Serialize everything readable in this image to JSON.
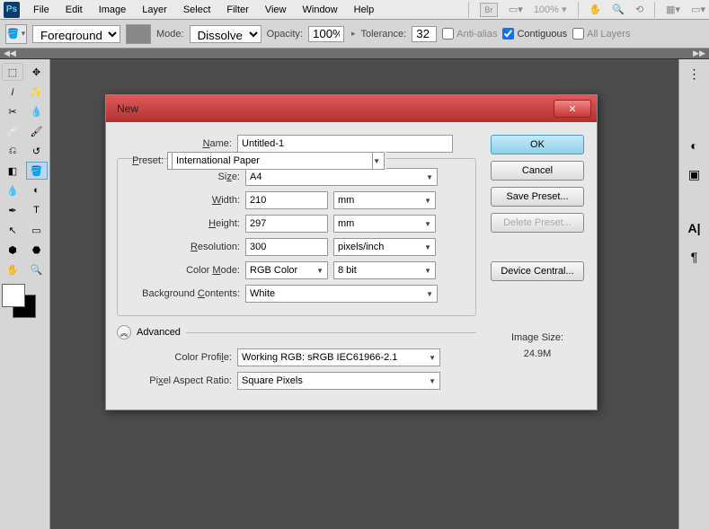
{
  "menubar": {
    "items": [
      "File",
      "Edit",
      "Image",
      "Layer",
      "Select",
      "Filter",
      "View",
      "Window",
      "Help"
    ],
    "zoom": "100%"
  },
  "optionsbar": {
    "fill_dd": "Foreground",
    "mode_label": "Mode:",
    "mode_value": "Dissolve",
    "opacity_label": "Opacity:",
    "opacity_value": "100%",
    "tolerance_label": "Tolerance:",
    "tolerance_value": "32",
    "antialias_label": "Anti-alias",
    "contiguous_label": "Contiguous",
    "alllayers_label": "All Layers"
  },
  "dialog": {
    "title": "New",
    "labels": {
      "name": "Name:",
      "preset": "Preset:",
      "size": "Size:",
      "width": "Width:",
      "height": "Height:",
      "resolution": "Resolution:",
      "colormode": "Color Mode:",
      "bgcontents": "Background Contents:",
      "advanced": "Advanced",
      "colorprofile": "Color Profile:",
      "pixelaspect": "Pixel Aspect Ratio:"
    },
    "values": {
      "name": "Untitled-1",
      "preset": "International Paper",
      "size": "A4",
      "width": "210",
      "width_unit": "mm",
      "height": "297",
      "height_unit": "mm",
      "resolution": "300",
      "resolution_unit": "pixels/inch",
      "colormode": "RGB Color",
      "bitdepth": "8 bit",
      "bgcontents": "White",
      "colorprofile": "Working RGB:  sRGB IEC61966-2.1",
      "pixelaspect": "Square Pixels"
    },
    "buttons": {
      "ok": "OK",
      "cancel": "Cancel",
      "save_preset": "Save Preset...",
      "delete_preset": "Delete Preset...",
      "device_central": "Device Central..."
    },
    "image_size_label": "Image Size:",
    "image_size_value": "24.9M"
  }
}
